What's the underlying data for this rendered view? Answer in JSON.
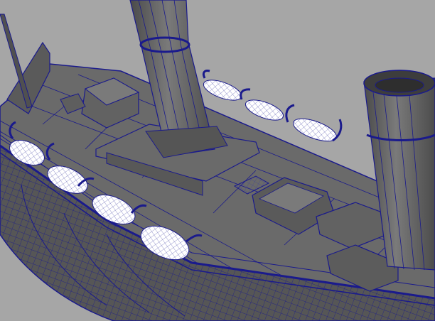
{
  "viewport": {
    "background": "#a6a6a6",
    "wireframe_color": "#1a1a8c",
    "hull_color": "#5c5c5c",
    "deck_color": "#6e6e6e",
    "lifeboat_color": "#ffffff"
  },
  "scene": {
    "objects": [
      {
        "name": "hull",
        "icon": "ship-hull"
      },
      {
        "name": "main-deck",
        "icon": "deck"
      },
      {
        "name": "funnel",
        "icon": "cylinder"
      },
      {
        "name": "funnel",
        "icon": "cylinder"
      },
      {
        "name": "lifeboat",
        "icon": "wireframe-boat"
      },
      {
        "name": "davit",
        "icon": "hook"
      },
      {
        "name": "deckhouse",
        "icon": "box"
      },
      {
        "name": "mast",
        "icon": "pole"
      }
    ]
  }
}
